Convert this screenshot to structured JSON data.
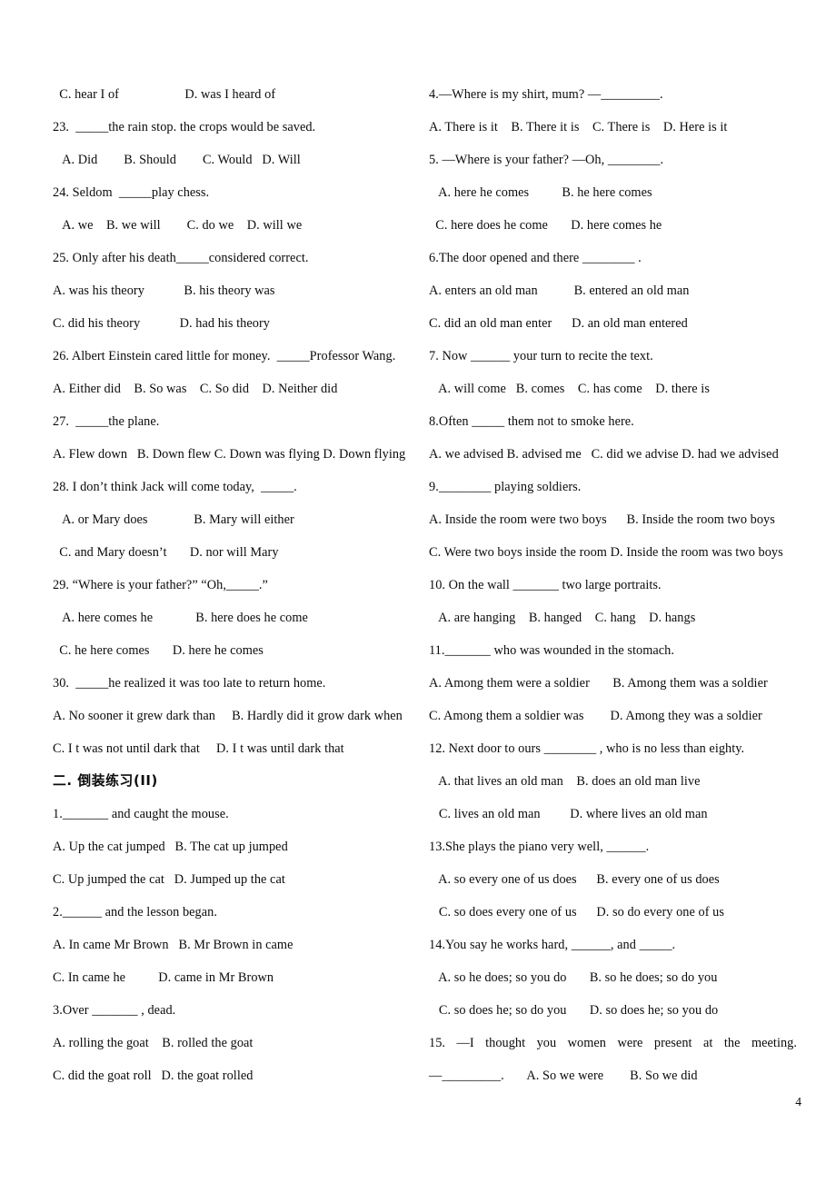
{
  "document": {
    "page_number": "4",
    "section_heading": "二. 倒装练习(II)"
  },
  "left_column": {
    "lines": [
      "  C. hear I of                    D. was I heard of",
      "23.  _____the rain stop. the crops would be saved.",
      "   A. Did        B. Should        C. Would   D. Will",
      "24. Seldom  _____play chess.",
      "   A. we    B. we will        C. do we    D. will we",
      "25. Only after his death_____considered correct.",
      "A. was his theory            B. his theory was",
      "C. did his theory            D. had his theory",
      "26. Albert Einstein cared little for money.  _____Professor Wang.",
      "A. Either did    B. So was    C. So did    D. Neither did",
      "27.  _____the plane.",
      "A. Flew down   B. Down flew C. Down was flying D. Down flying",
      "28. I don’t think Jack will come today,  _____.",
      "   A. or Mary does              B. Mary will either",
      "  C. and Mary doesn’t       D. nor will Mary",
      "29. “Where is your father?” “Oh,_____.”",
      "   A. here comes he             B. here does he come",
      "  C. he here comes       D. here he comes",
      "30.  _____he realized it was too late to return home.",
      "A. No sooner it grew dark than     B. Hardly did it grow dark when",
      "C. I t was not until dark that     D. I t was until dark that",
      "二. 倒装练习(II)",
      "1._______ and caught the mouse.",
      "A. Up the cat jumped   B. The cat up jumped",
      "C. Up jumped the cat   D. Jumped up the cat",
      "2.______ and the lesson began.",
      "A. In came Mr Brown   B. Mr Brown in came",
      "C. In came he          D. came in Mr Brown",
      "3.Over _______ , dead.",
      "A. rolling the goat    B. rolled the goat",
      "C. did the goat roll   D. the goat rolled"
    ],
    "heading_index": 21
  },
  "right_column": {
    "lines": [
      "4.—Where is my shirt, mum? —_________.",
      "A. There is it    B. There it is    C. There is    D. Here is it",
      "5. —Where is your father? —Oh, ________.",
      "   A. here he comes          B. he here comes",
      "  C. here does he come       D. here comes he",
      "6.The door opened and there ________ .",
      "A. enters an old man           B. entered an old man",
      "C. did an old man enter      D. an old man entered",
      "7. Now ______ your turn to recite the text.",
      "   A. will come   B. comes    C. has come    D. there is",
      "8.Often _____ them not to smoke here.",
      "A. we advised B. advised me   C. did we advise D. had we advised",
      "9.________ playing soldiers.",
      "A. Inside the room were two boys      B. Inside the room two boys",
      "C. Were two boys inside the room D. Inside the room was two boys",
      "10. On the wall _______ two large portraits.",
      "   A. are hanging    B. hanged    C. hang    D. hangs",
      "11._______ who was wounded in the stomach.",
      "A. Among them were a soldier       B. Among them was a soldier",
      "C. Among them a soldier was        D. Among they was a soldier",
      "12. Next door to ours ________ , who is no less than eighty.",
      "   A. that lives an old man    B. does an old man live",
      "   C. lives an old man         D. where lives an old man",
      "13.She plays the piano very well, ______.",
      "   A. so every one of us does      B. every one of us does",
      "   C. so does every one of us      D. so do every one of us",
      "14.You say he works hard, ______, and _____.",
      "   A. so he does; so you do       B. so he does; so do you",
      "   C. so does he; so do you       D. so does he; so you do",
      "15.  —I thought you women were present at the meeting.",
      "—_________.       A. So we were        B. So we did"
    ],
    "justified_index": 29
  }
}
